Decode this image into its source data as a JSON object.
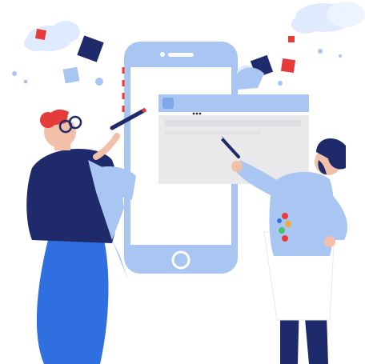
{
  "illustration": {
    "subject": "designers-sketching-mobile-app",
    "palette": {
      "navy": "#1f2a6b",
      "blue": "#2f6fe0",
      "light_blue": "#a9c6f3",
      "pale_blue": "#dfeaff",
      "red": "#e63b3b",
      "grey": "#e8e8ea",
      "skin": "#f2c0a8"
    },
    "icons": [
      "cloud-icon",
      "phone-icon",
      "browser-window-icon",
      "pencil-icon",
      "paint-palette-icon",
      "confetti-icon"
    ]
  }
}
